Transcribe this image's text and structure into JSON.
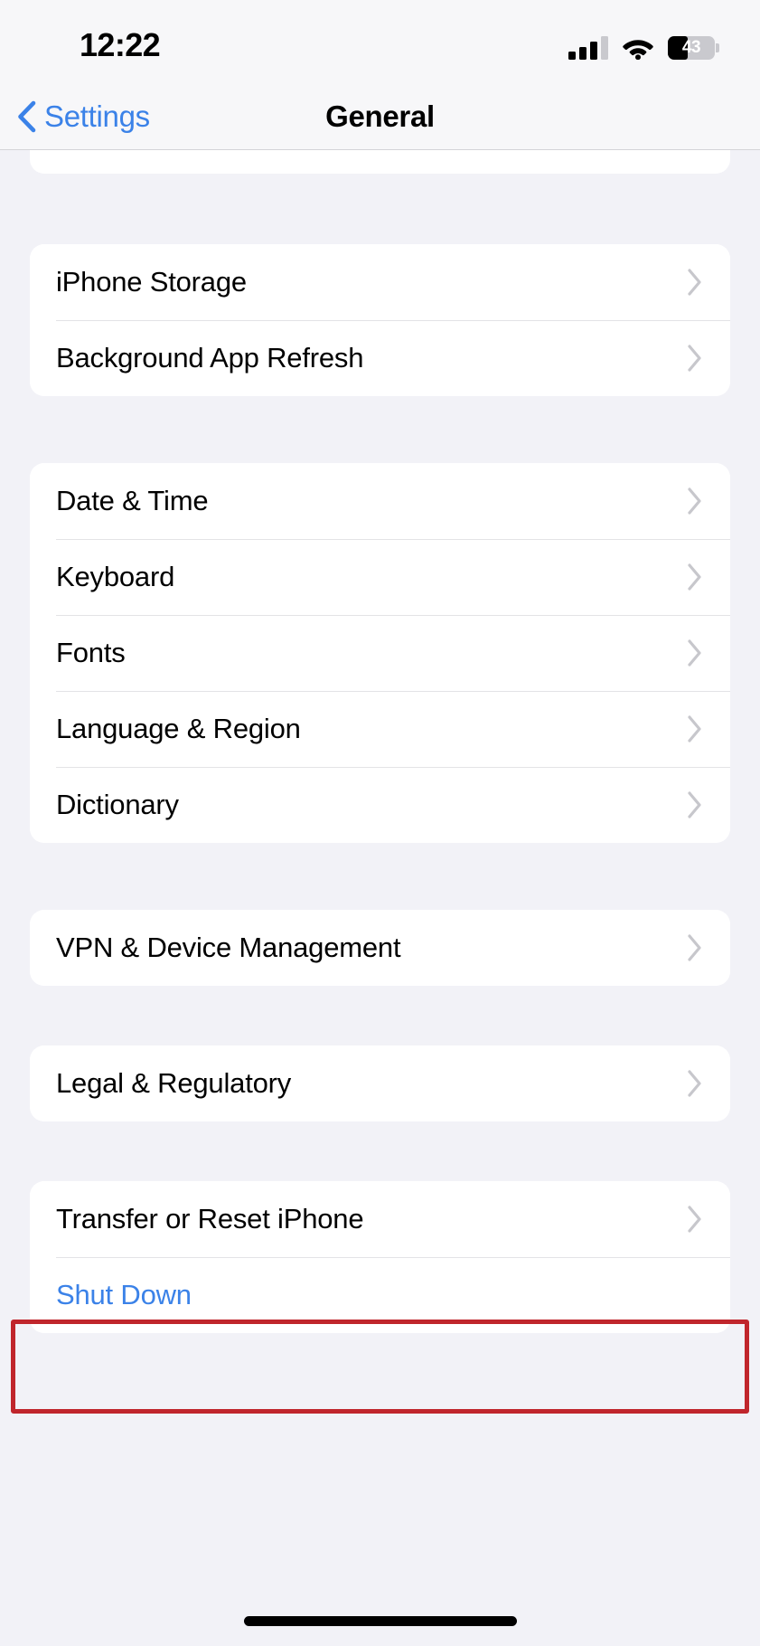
{
  "status_bar": {
    "time": "12:22",
    "cellular_icon": "cellular-bars-icon",
    "cellular_bars_total": 4,
    "cellular_bars_filled": 3,
    "wifi_icon": "wifi-icon",
    "battery_icon": "battery-icon",
    "battery_percent_label": "43",
    "battery_percent_value": 43
  },
  "nav_bar": {
    "back_icon": "chevron-left-icon",
    "back_label": "Settings",
    "title": "General"
  },
  "colors": {
    "accent_blue": "#3B82E8",
    "page_background": "#F2F2F7",
    "card_background": "#FFFFFF",
    "separator": "#E3E3E6",
    "chevron_gray": "#C7C7CC",
    "highlight_red": "#C0262C",
    "status_bar_background": "#F7F7F9"
  },
  "highlight": {
    "target_row_label": "Transfer or Reset iPhone",
    "border_color": "#C0262C"
  },
  "groups": [
    {
      "id": "group-partial-top",
      "partial": true,
      "rows": []
    },
    {
      "id": "group-storage",
      "rows": [
        {
          "label": "iPhone Storage",
          "accessory": "chevron-right-icon",
          "style": "default"
        },
        {
          "label": "Background App Refresh",
          "accessory": "chevron-right-icon",
          "style": "default"
        }
      ]
    },
    {
      "id": "group-localization",
      "rows": [
        {
          "label": "Date & Time",
          "accessory": "chevron-right-icon",
          "style": "default"
        },
        {
          "label": "Keyboard",
          "accessory": "chevron-right-icon",
          "style": "default"
        },
        {
          "label": "Fonts",
          "accessory": "chevron-right-icon",
          "style": "default"
        },
        {
          "label": "Language & Region",
          "accessory": "chevron-right-icon",
          "style": "default"
        },
        {
          "label": "Dictionary",
          "accessory": "chevron-right-icon",
          "style": "default"
        }
      ]
    },
    {
      "id": "group-vpn",
      "rows": [
        {
          "label": "VPN & Device Management",
          "accessory": "chevron-right-icon",
          "style": "default"
        }
      ]
    },
    {
      "id": "group-legal",
      "rows": [
        {
          "label": "Legal & Regulatory",
          "accessory": "chevron-right-icon",
          "style": "default"
        }
      ]
    },
    {
      "id": "group-reset",
      "rows": [
        {
          "label": "Transfer or Reset iPhone",
          "accessory": "chevron-right-icon",
          "style": "default"
        },
        {
          "label": "Shut Down",
          "accessory": "none",
          "style": "link"
        }
      ]
    }
  ],
  "home_indicator": "home-indicator"
}
